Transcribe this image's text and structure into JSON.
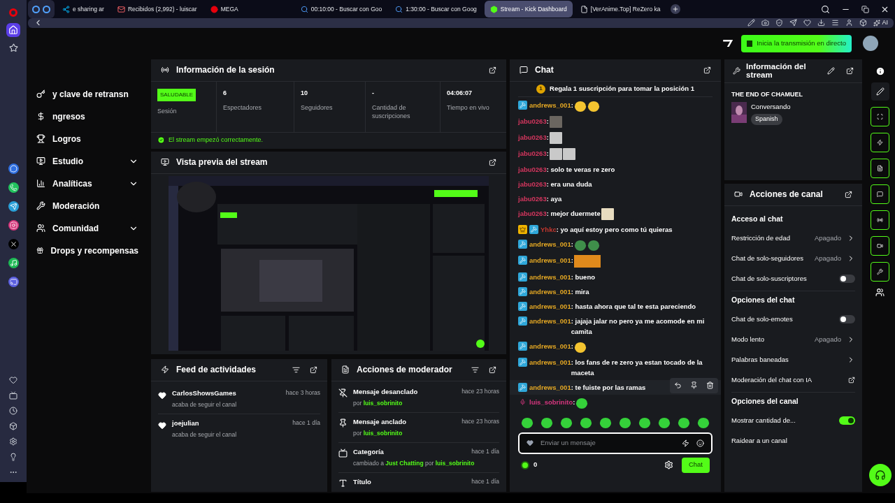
{
  "browser": {
    "tabs": [
      {
        "kind": "share",
        "label": "e sharing ar",
        "selected": false
      },
      {
        "kind": "mail",
        "label": "Recibidos (2,992) - luiscar",
        "selected": false
      },
      {
        "kind": "mega",
        "label": "MEGA",
        "selected": false
      },
      {
        "kind": "search",
        "label": "00:10:00 - Buscar con Goo",
        "selected": false
      },
      {
        "kind": "search",
        "label": "1:30:00 - Buscar con Goog",
        "selected": false
      },
      {
        "kind": "kick",
        "label": "Stream - Kick Dashboard",
        "selected": true
      },
      {
        "kind": "page",
        "label": "[VerAnime.Top] ReZero ka",
        "selected": false
      }
    ],
    "ai_label": "AI"
  },
  "header": {
    "live_button": "Inicia la transmisión en directo"
  },
  "nav": [
    {
      "kind": "key",
      "label": "y clave de retransn",
      "submenu": false
    },
    {
      "kind": "money",
      "label": "ngresos",
      "submenu": false
    },
    {
      "kind": "trophy",
      "label": "Logros",
      "submenu": false
    },
    {
      "kind": "studio",
      "label": "Estudio",
      "submenu": true
    },
    {
      "kind": "chart",
      "label": "Analíticas",
      "submenu": true
    },
    {
      "kind": "wrench",
      "label": "Moderación",
      "submenu": false
    },
    {
      "kind": "users",
      "label": "Comunidad",
      "submenu": true
    },
    {
      "kind": "gift",
      "label": "Drops y recompensas",
      "submenu": false
    }
  ],
  "session": {
    "title": "Información de la sesión",
    "stats": [
      {
        "kind": "badge",
        "value": "SALUDABLE",
        "label": "Sesión"
      },
      {
        "kind": "number",
        "value": "6",
        "label": "Espectadores"
      },
      {
        "kind": "number",
        "value": "10",
        "label": "Seguidores"
      },
      {
        "kind": "number",
        "value": "-",
        "label": "Cantidad de suscripciones"
      },
      {
        "kind": "number",
        "value": "04:06:07",
        "label": "Tiempo en vivo"
      }
    ],
    "notice": "El stream empezó correctamente."
  },
  "preview": {
    "title": "Vista previa del stream",
    "kind": "picture"
  },
  "feed": {
    "title": "Feed de actividades",
    "items": [
      {
        "name": "CarlosShowsGames",
        "time": "hace 3 horas",
        "detail": "acaba de seguir el canal"
      },
      {
        "name": "joejulian",
        "time": "hace 1 día",
        "detail": "acaba de seguir el canal"
      }
    ]
  },
  "mod_actions": {
    "title": "Acciones de moderador",
    "items": [
      {
        "kind": "unpin",
        "title": "Mensaje desanclado",
        "time": "hace 23 horas",
        "detail": [
          {
            "kind": "plain",
            "text": "por "
          },
          {
            "kind": "link",
            "text": "luis_sobrinito"
          }
        ]
      },
      {
        "kind": "pin",
        "title": "Mensaje anclado",
        "time": "hace 23 horas",
        "detail": [
          {
            "kind": "plain",
            "text": "por "
          },
          {
            "kind": "link",
            "text": "luis_sobrinito"
          }
        ]
      },
      {
        "kind": "category",
        "title": "Categoría",
        "time": "hace 1 día",
        "detail": [
          {
            "kind": "plain",
            "text": "cambiado a "
          },
          {
            "kind": "link",
            "text": "Just Chatting"
          },
          {
            "kind": "plain",
            "text": " por "
          },
          {
            "kind": "link",
            "text": "luis_sobrinito"
          }
        ]
      },
      {
        "kind": "title",
        "title": "Título",
        "time": "hace 1 día"
      }
    ]
  },
  "chat": {
    "title": "Chat",
    "pinned": "Regala 1 suscripción para tomar la posición 1",
    "pinned_rank": "1",
    "messages": [
      {
        "badges": [
          {
            "kind": "mod"
          }
        ],
        "user": "andrews_001",
        "color": "#e5a823",
        "text": ":",
        "emotes": [
          {
            "kind": "duck"
          },
          {
            "kind": "duck"
          }
        ],
        "hovered": false
      },
      {
        "user": "jabu0263",
        "color": "#d4365e",
        "text": ":",
        "hovered": false
      },
      {
        "user": "jabu0263",
        "color": "#d4365e",
        "text": ":",
        "emotes": [
          {
            "kind": "cat"
          }
        ],
        "hovered": false
      },
      {
        "user": "jabu0263",
        "color": "#d4365e",
        "text": ":",
        "emotes": [
          {
            "kind": "cat"
          },
          {
            "kind": "cat"
          }
        ],
        "hovered": false
      },
      {
        "user": "jabu0263",
        "color": "#d4365e",
        "text": ": solo te veras re zero",
        "hovered": false
      },
      {
        "user": "jabu0263",
        "color": "#d4365e",
        "text": ": era una duda",
        "hovered": false
      },
      {
        "user": "jabu0263",
        "color": "#d4365e",
        "text": ": aya",
        "hovered": false
      },
      {
        "user": "jabu0263",
        "color": "#d4365e",
        "text": ": mejor duermete",
        "emotes": [
          {
            "kind": "paper"
          }
        ],
        "hovered": false
      },
      {
        "badges": [
          {
            "kind": "crown"
          },
          {
            "kind": "mod"
          }
        ],
        "user": "Yhkc",
        "color": "#c4372f",
        "text": ": yo aquí estoy pero como tú quieras",
        "hovered": false
      },
      {
        "badges": [
          {
            "kind": "mod"
          }
        ],
        "user": "andrews_001",
        "color": "#e5a823",
        "text": ":",
        "emotes": [
          {
            "kind": "frog"
          },
          {
            "kind": "frog"
          }
        ],
        "hovered": false
      },
      {
        "badges": [
          {
            "kind": "mod"
          }
        ],
        "user": "andrews_001",
        "color": "#e5a823",
        "text": ":",
        "emotes": [
          {
            "kind": "fire"
          }
        ],
        "hovered": false
      },
      {
        "badges": [
          {
            "kind": "mod"
          }
        ],
        "user": "andrews_001",
        "color": "#e5a823",
        "text": ": bueno",
        "hovered": false
      },
      {
        "badges": [
          {
            "kind": "mod"
          }
        ],
        "user": "andrews_001",
        "color": "#e5a823",
        "text": ": mira",
        "hovered": false
      },
      {
        "badges": [
          {
            "kind": "mod"
          }
        ],
        "user": "andrews_001",
        "color": "#e5a823",
        "text": ": hasta ahora que tal te esta pareciendo",
        "hovered": false
      },
      {
        "badges": [
          {
            "kind": "mod"
          }
        ],
        "user": "andrews_001",
        "color": "#e5a823",
        "text": ": jajaja jalar no pero ya me acomode en mi camita",
        "hovered": false
      },
      {
        "badges": [
          {
            "kind": "mod"
          }
        ],
        "user": "andrews_001",
        "color": "#e5a823",
        "text": ":",
        "emotes": [
          {
            "kind": "duck"
          }
        ],
        "hovered": false
      },
      {
        "badges": [
          {
            "kind": "mod"
          }
        ],
        "user": "andrews_001",
        "color": "#e5a823",
        "text": ": los fans de re zero ya estan tocado de la maceta",
        "hovered": false
      },
      {
        "badges": [
          {
            "kind": "mod"
          }
        ],
        "user": "andrews_001",
        "color": "#e5a823",
        "text": ": te fuiste por las ramas",
        "hovered": true
      },
      {
        "badges": [
          {
            "kind": "mic"
          }
        ],
        "user": "luis_sobrinito",
        "color": "#d6367f",
        "text": ":",
        "emotes": [
          {
            "kind": "blob"
          }
        ],
        "hovered": false
      }
    ],
    "quick_emotes": [
      {
        "kind": "blob"
      },
      {
        "kind": "blob"
      },
      {
        "kind": "blob"
      },
      {
        "kind": "blob"
      },
      {
        "kind": "blob"
      },
      {
        "kind": "blob"
      },
      {
        "kind": "blob"
      },
      {
        "kind": "blob"
      },
      {
        "kind": "blob"
      },
      {
        "kind": "blob"
      }
    ],
    "input": {
      "placeholder": "Enviar un mensaje"
    },
    "points": "0",
    "send_button": "Chat"
  },
  "stream_info": {
    "title": "Información del stream",
    "stream_title": "THE END OF CHAMUEL",
    "category": "Conversando",
    "tag": "Spanish"
  },
  "channel_actions": {
    "title": "Acciones de canal",
    "sections": [
      {
        "heading": "Acceso al chat",
        "rows": [
          {
            "kind": "link",
            "label": "Restricción de edad",
            "value": "Apagado"
          },
          {
            "kind": "link",
            "label": "Chat de solo-seguidores",
            "value": "Apagado"
          },
          {
            "kind": "toggle",
            "label": "Chat de solo-suscriptores",
            "on": false
          }
        ]
      },
      {
        "heading": "Opciones del chat",
        "rows": [
          {
            "kind": "toggle",
            "label": "Chat de solo-emotes",
            "on": false
          },
          {
            "kind": "link",
            "label": "Modo lento",
            "value": "Apagado"
          },
          {
            "kind": "link",
            "label": "Palabras baneadas"
          },
          {
            "kind": "external",
            "label": "Moderación del chat con IA"
          }
        ]
      },
      {
        "heading": "Opciones del canal",
        "rows": [
          {
            "kind": "toggle",
            "label": "Mostrar cantidad de...",
            "on": true
          },
          {
            "kind": "plain",
            "label": "Raidear a un canal"
          }
        ]
      }
    ]
  }
}
